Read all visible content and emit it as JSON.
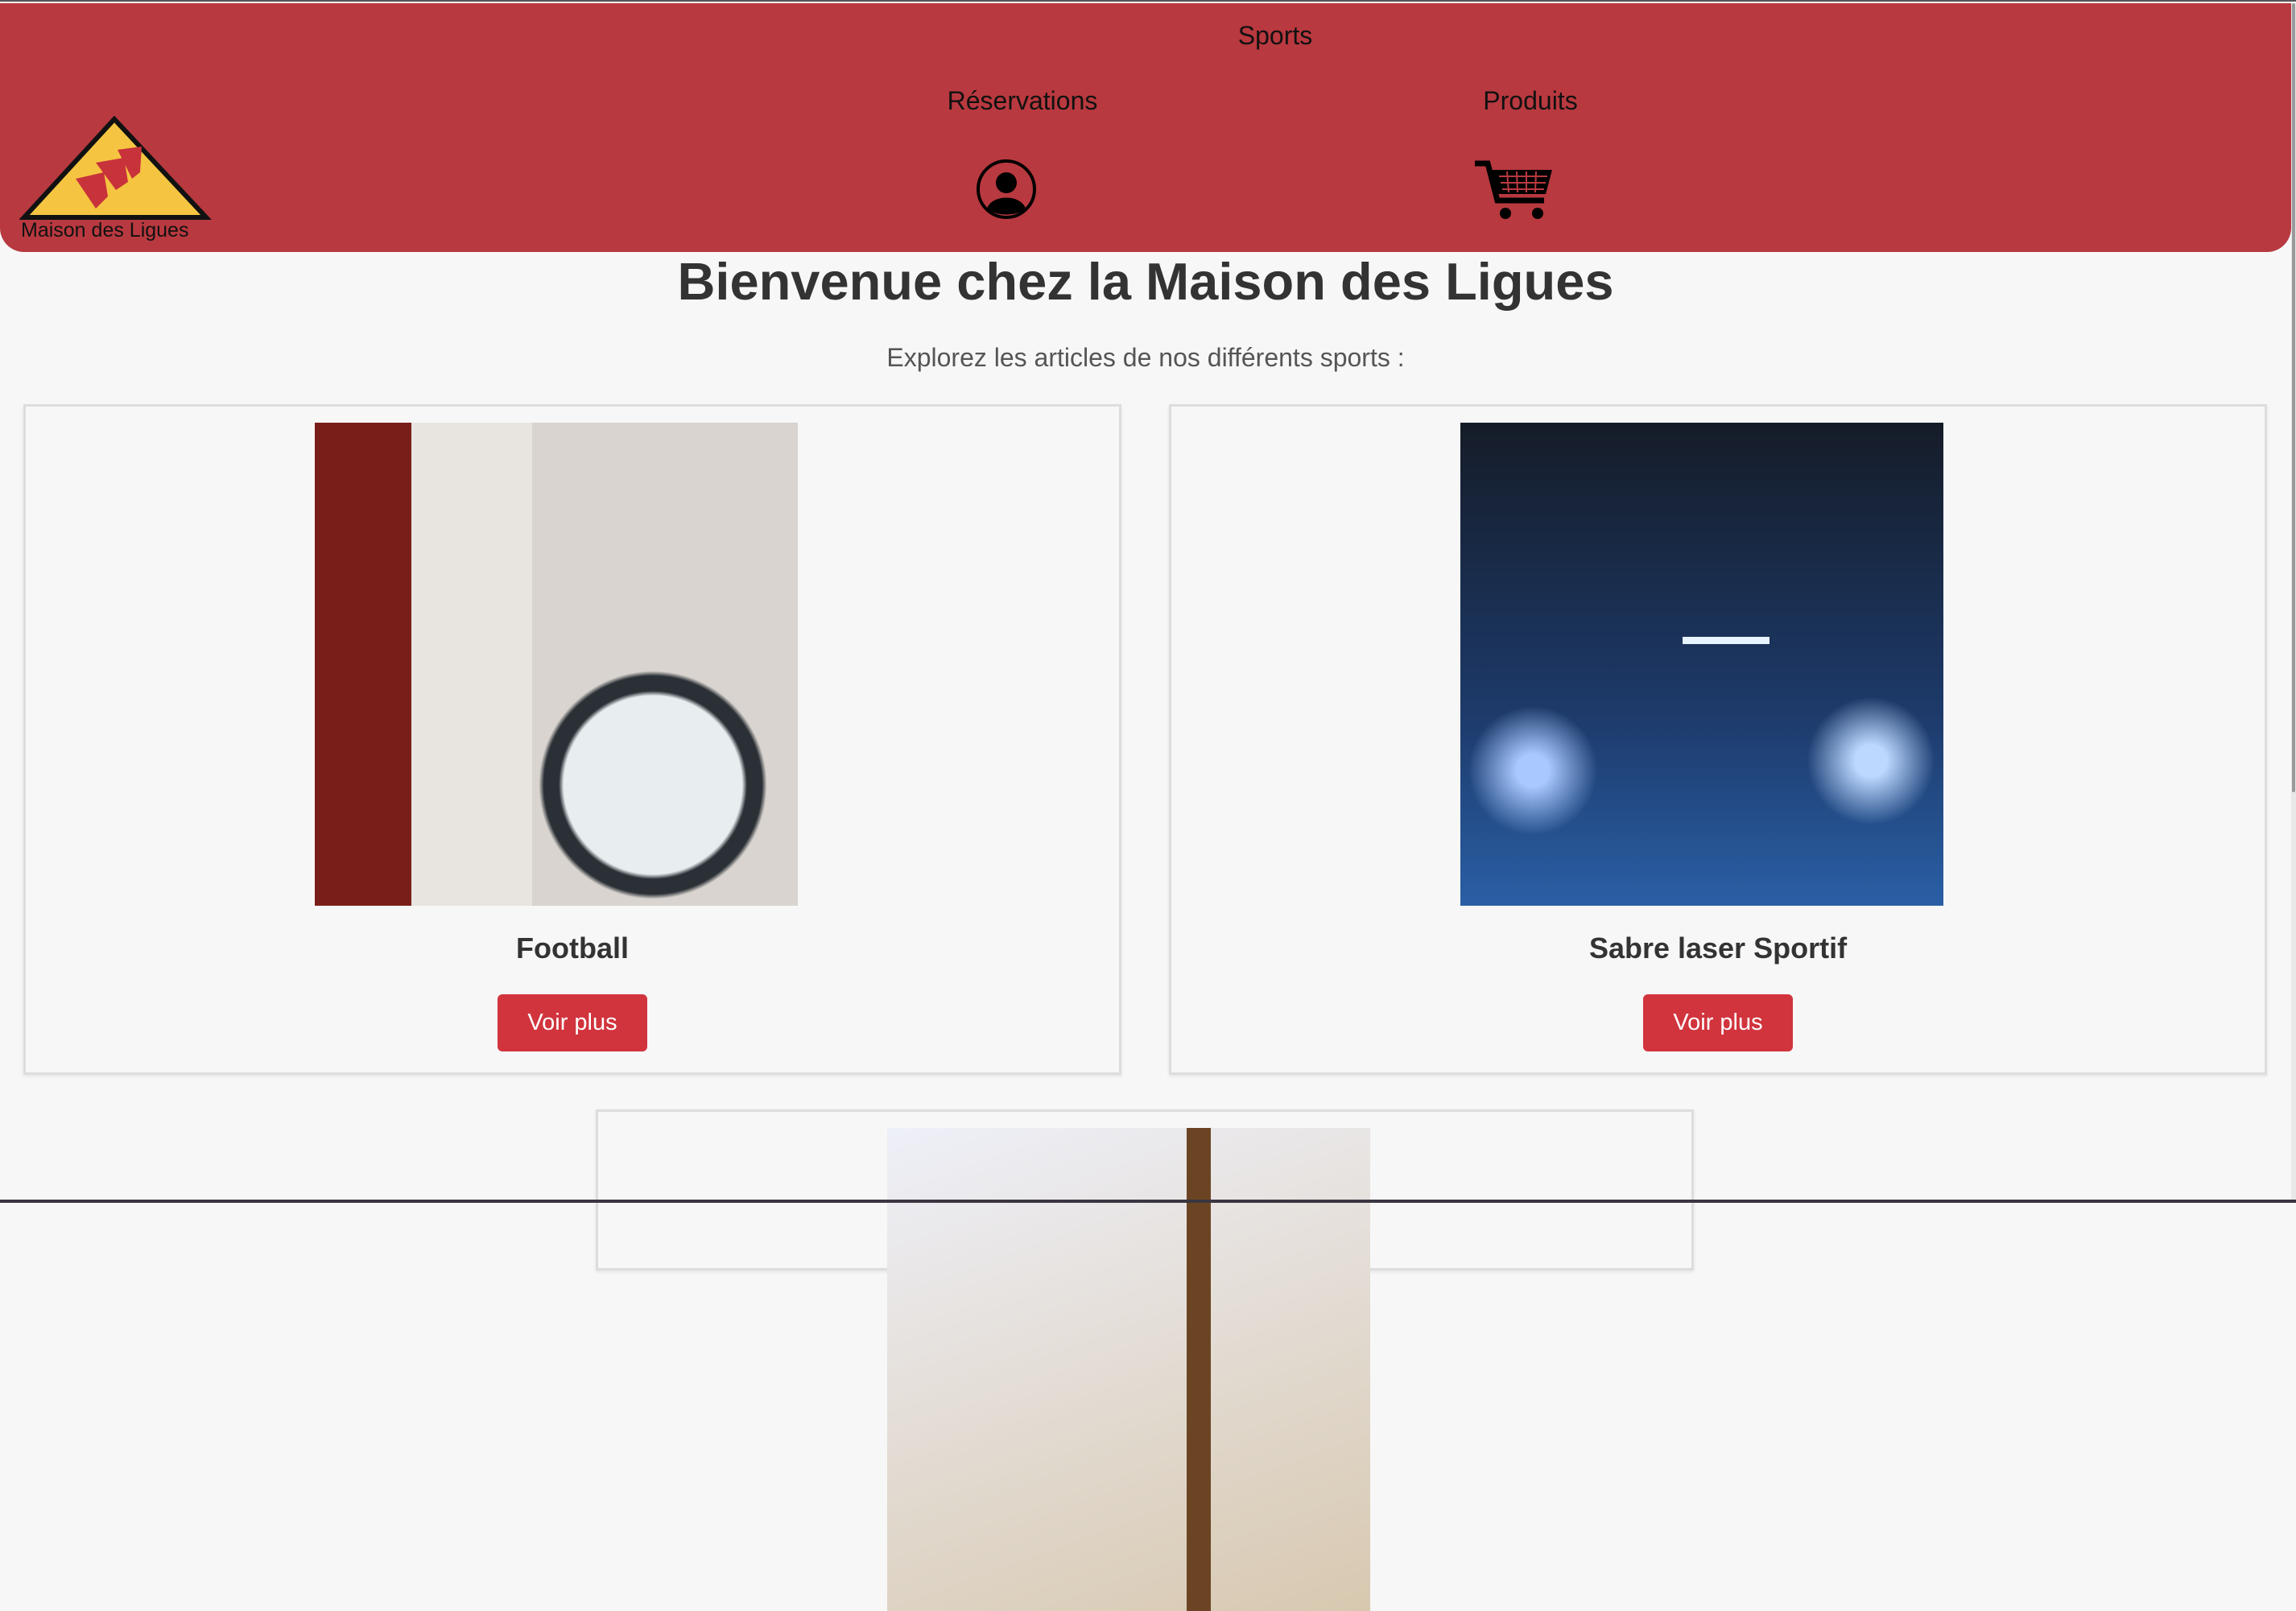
{
  "header": {
    "nav": {
      "sports": "Sports",
      "reservations": "Réservations",
      "produits": "Produits"
    },
    "logo_text": "Maison des Ligues"
  },
  "main": {
    "title": "Bienvenue chez la Maison des Ligues",
    "subtitle": "Explorez les articles de nos différents sports :",
    "cards": [
      {
        "title": "Football",
        "button": "Voir plus"
      },
      {
        "title": "Sabre laser Sportif",
        "button": "Voir plus"
      }
    ]
  },
  "colors": {
    "header": "#b8393f",
    "button": "#d1343d"
  }
}
